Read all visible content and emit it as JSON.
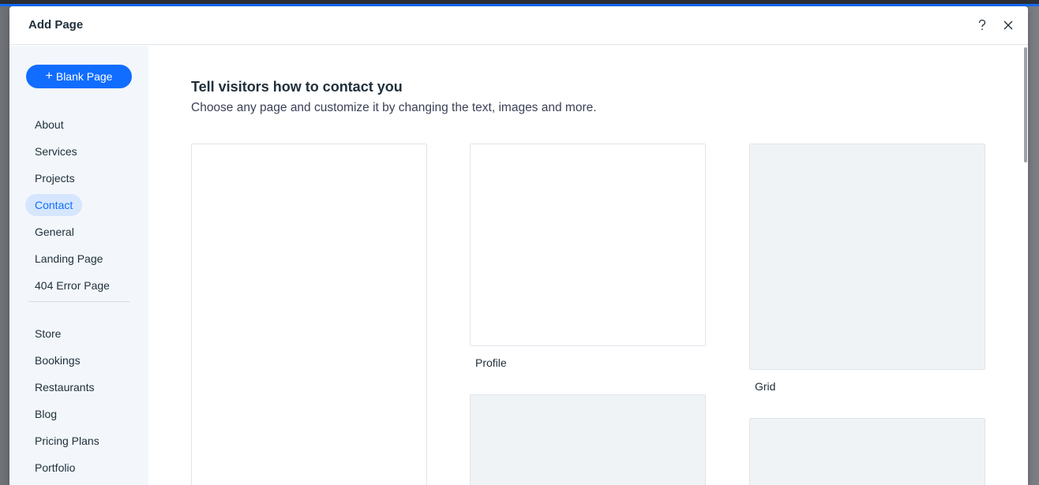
{
  "modal": {
    "title": "Add Page",
    "help_icon": "question-mark-icon",
    "close_icon": "close-icon"
  },
  "sidebar": {
    "blank_button_label": "Blank Page",
    "blank_button_icon": "plus-icon",
    "items_group1": [
      "About",
      "Services",
      "Projects",
      "Contact",
      "General",
      "Landing Page",
      "404 Error Page"
    ],
    "items_group2": [
      "Store",
      "Bookings",
      "Restaurants",
      "Blog",
      "Pricing Plans",
      "Portfolio"
    ],
    "selected": "Contact"
  },
  "main": {
    "title": "Tell visitors how to contact you",
    "subtitle": "Choose any page and customize it by changing the text, images and more.",
    "templates": [
      {
        "label": ""
      },
      {
        "label": "Profile"
      },
      {
        "label": "Grid"
      },
      {
        "label": ""
      },
      {
        "label": ""
      }
    ]
  },
  "colors": {
    "accent": "#116dff",
    "selected_bg": "#d6e6fe",
    "sidebar_bg": "#f3f7fb",
    "placeholder_grey": "#eff3f6"
  }
}
